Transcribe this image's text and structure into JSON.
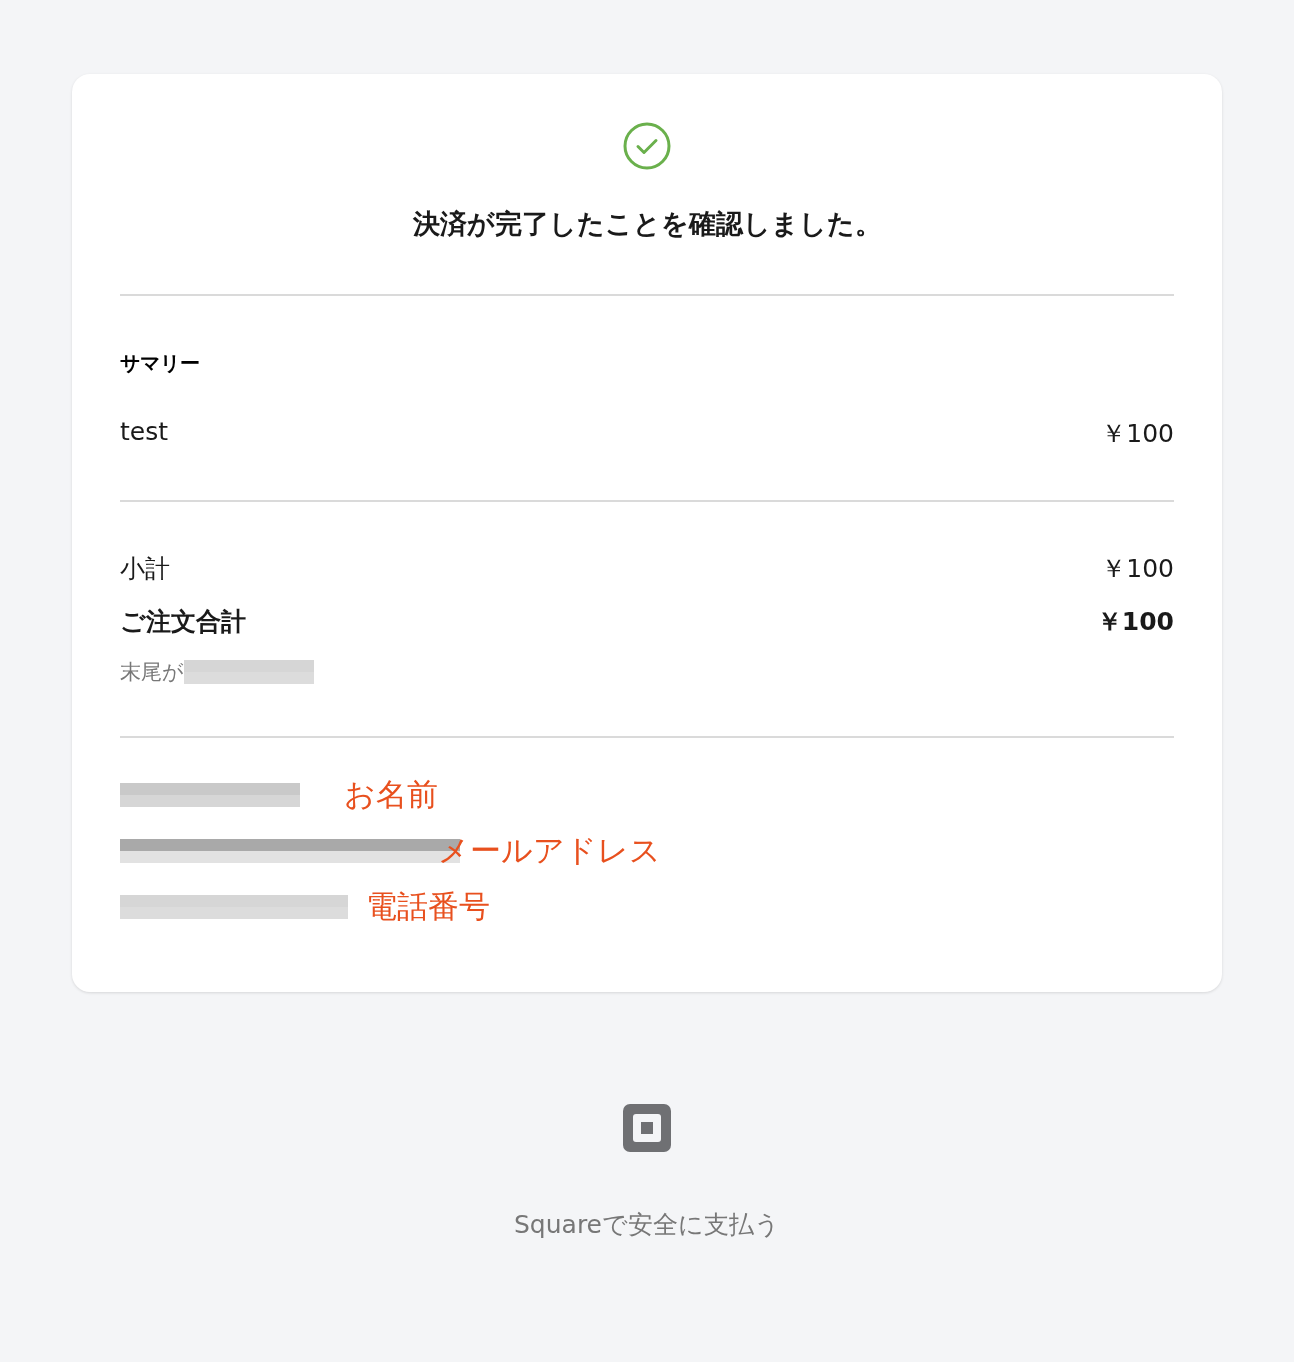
{
  "title": "決済が完了したことを確認しました。",
  "summary": {
    "heading": "サマリー",
    "items": [
      {
        "name": "test",
        "price": "￥100"
      }
    ]
  },
  "totals": [
    {
      "label": "小計",
      "amount": "￥100",
      "kind": "normal"
    },
    {
      "label": "ご注文合計",
      "amount": "￥100",
      "kind": "total"
    }
  ],
  "card_note": "末尾が",
  "contact": [
    {
      "annotation": "お名前"
    },
    {
      "annotation": "メールアドレス"
    },
    {
      "annotation": "電話番号"
    }
  ],
  "footer": {
    "text": "Squareで安全に支払う"
  }
}
